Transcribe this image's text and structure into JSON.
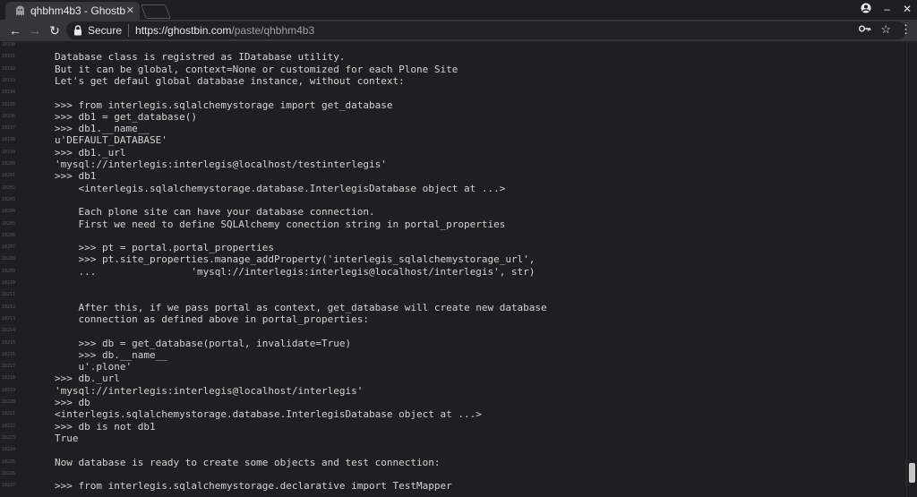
{
  "browser": {
    "tab_title": "qhbhm4b3 - Ghostb",
    "secure_label": "Secure",
    "url_host": "https://ghostbin.com",
    "url_path": "/paste/qhbhm4b3"
  },
  "icons": {
    "favicon": "ghost-icon",
    "back": "arrow-left-icon",
    "forward": "arrow-right-icon",
    "reload": "reload-icon",
    "lock": "lock-icon",
    "key": "key-icon",
    "star": "star-icon",
    "menu": "kebab-menu-icon",
    "account": "account-icon",
    "minimize": "minimize-icon",
    "close": "close-icon"
  },
  "colors": {
    "background": "#1d1f21",
    "code_text": "#d3d3d3",
    "line_numbers": "#555759"
  },
  "lines": [
    {
      "n": "18190",
      "t": ""
    },
    {
      "n": "18191",
      "t": "Database class is registred as IDatabase utility."
    },
    {
      "n": "18192",
      "t": "But it can be global, context=None or customized for each Plone Site"
    },
    {
      "n": "18193",
      "t": "Let's get defaul global database instance, without context:"
    },
    {
      "n": "18194",
      "t": ""
    },
    {
      "n": "18195",
      "t": ">>> from interlegis.sqlalchemystorage import get_database"
    },
    {
      "n": "18196",
      "t": ">>> db1 = get_database()"
    },
    {
      "n": "18197",
      "t": ">>> db1.__name__"
    },
    {
      "n": "18198",
      "t": "u'DEFAULT_DATABASE'"
    },
    {
      "n": "18199",
      "t": ">>> db1._url"
    },
    {
      "n": "18200",
      "t": "'mysql://interlegis:interlegis@localhost/testinterlegis'"
    },
    {
      "n": "18201",
      "t": ">>> db1"
    },
    {
      "n": "18202",
      "t": "    <interlegis.sqlalchemystorage.database.InterlegisDatabase object at ...>"
    },
    {
      "n": "18203",
      "t": ""
    },
    {
      "n": "18204",
      "t": "    Each plone site can have your database connection."
    },
    {
      "n": "18205",
      "t": "    First we need to define SQLAlchemy conection string in portal_properties"
    },
    {
      "n": "18206",
      "t": ""
    },
    {
      "n": "18207",
      "t": "    >>> pt = portal.portal_properties"
    },
    {
      "n": "18208",
      "t": "    >>> pt.site_properties.manage_addProperty('interlegis_sqlalchemystorage_url',"
    },
    {
      "n": "18209",
      "t": "    ...                'mysql://interlegis:interlegis@localhost/interlegis', str)"
    },
    {
      "n": "18210",
      "t": ""
    },
    {
      "n": "18211",
      "t": ""
    },
    {
      "n": "18212",
      "t": "    After this, if we pass portal as context, get_database will create new database"
    },
    {
      "n": "18213",
      "t": "    connection as defined above in portal_properties:"
    },
    {
      "n": "18214",
      "t": ""
    },
    {
      "n": "18215",
      "t": "    >>> db = get_database(portal, invalidate=True)"
    },
    {
      "n": "18216",
      "t": "    >>> db.__name__"
    },
    {
      "n": "18217",
      "t": "    u'.plone'"
    },
    {
      "n": "18218",
      "t": ">>> db._url"
    },
    {
      "n": "18219",
      "t": "'mysql://interlegis:interlegis@localhost/interlegis'"
    },
    {
      "n": "18220",
      "t": ">>> db"
    },
    {
      "n": "18221",
      "t": "<interlegis.sqlalchemystorage.database.InterlegisDatabase object at ...>"
    },
    {
      "n": "18222",
      "t": ">>> db is not db1"
    },
    {
      "n": "18223",
      "t": "True"
    },
    {
      "n": "18224",
      "t": ""
    },
    {
      "n": "18225",
      "t": "Now database is ready to create some objects and test connection:"
    },
    {
      "n": "18226",
      "t": ""
    },
    {
      "n": "18227",
      "t": ">>> from interlegis.sqlalchemystorage.declarative import TestMapper"
    }
  ]
}
